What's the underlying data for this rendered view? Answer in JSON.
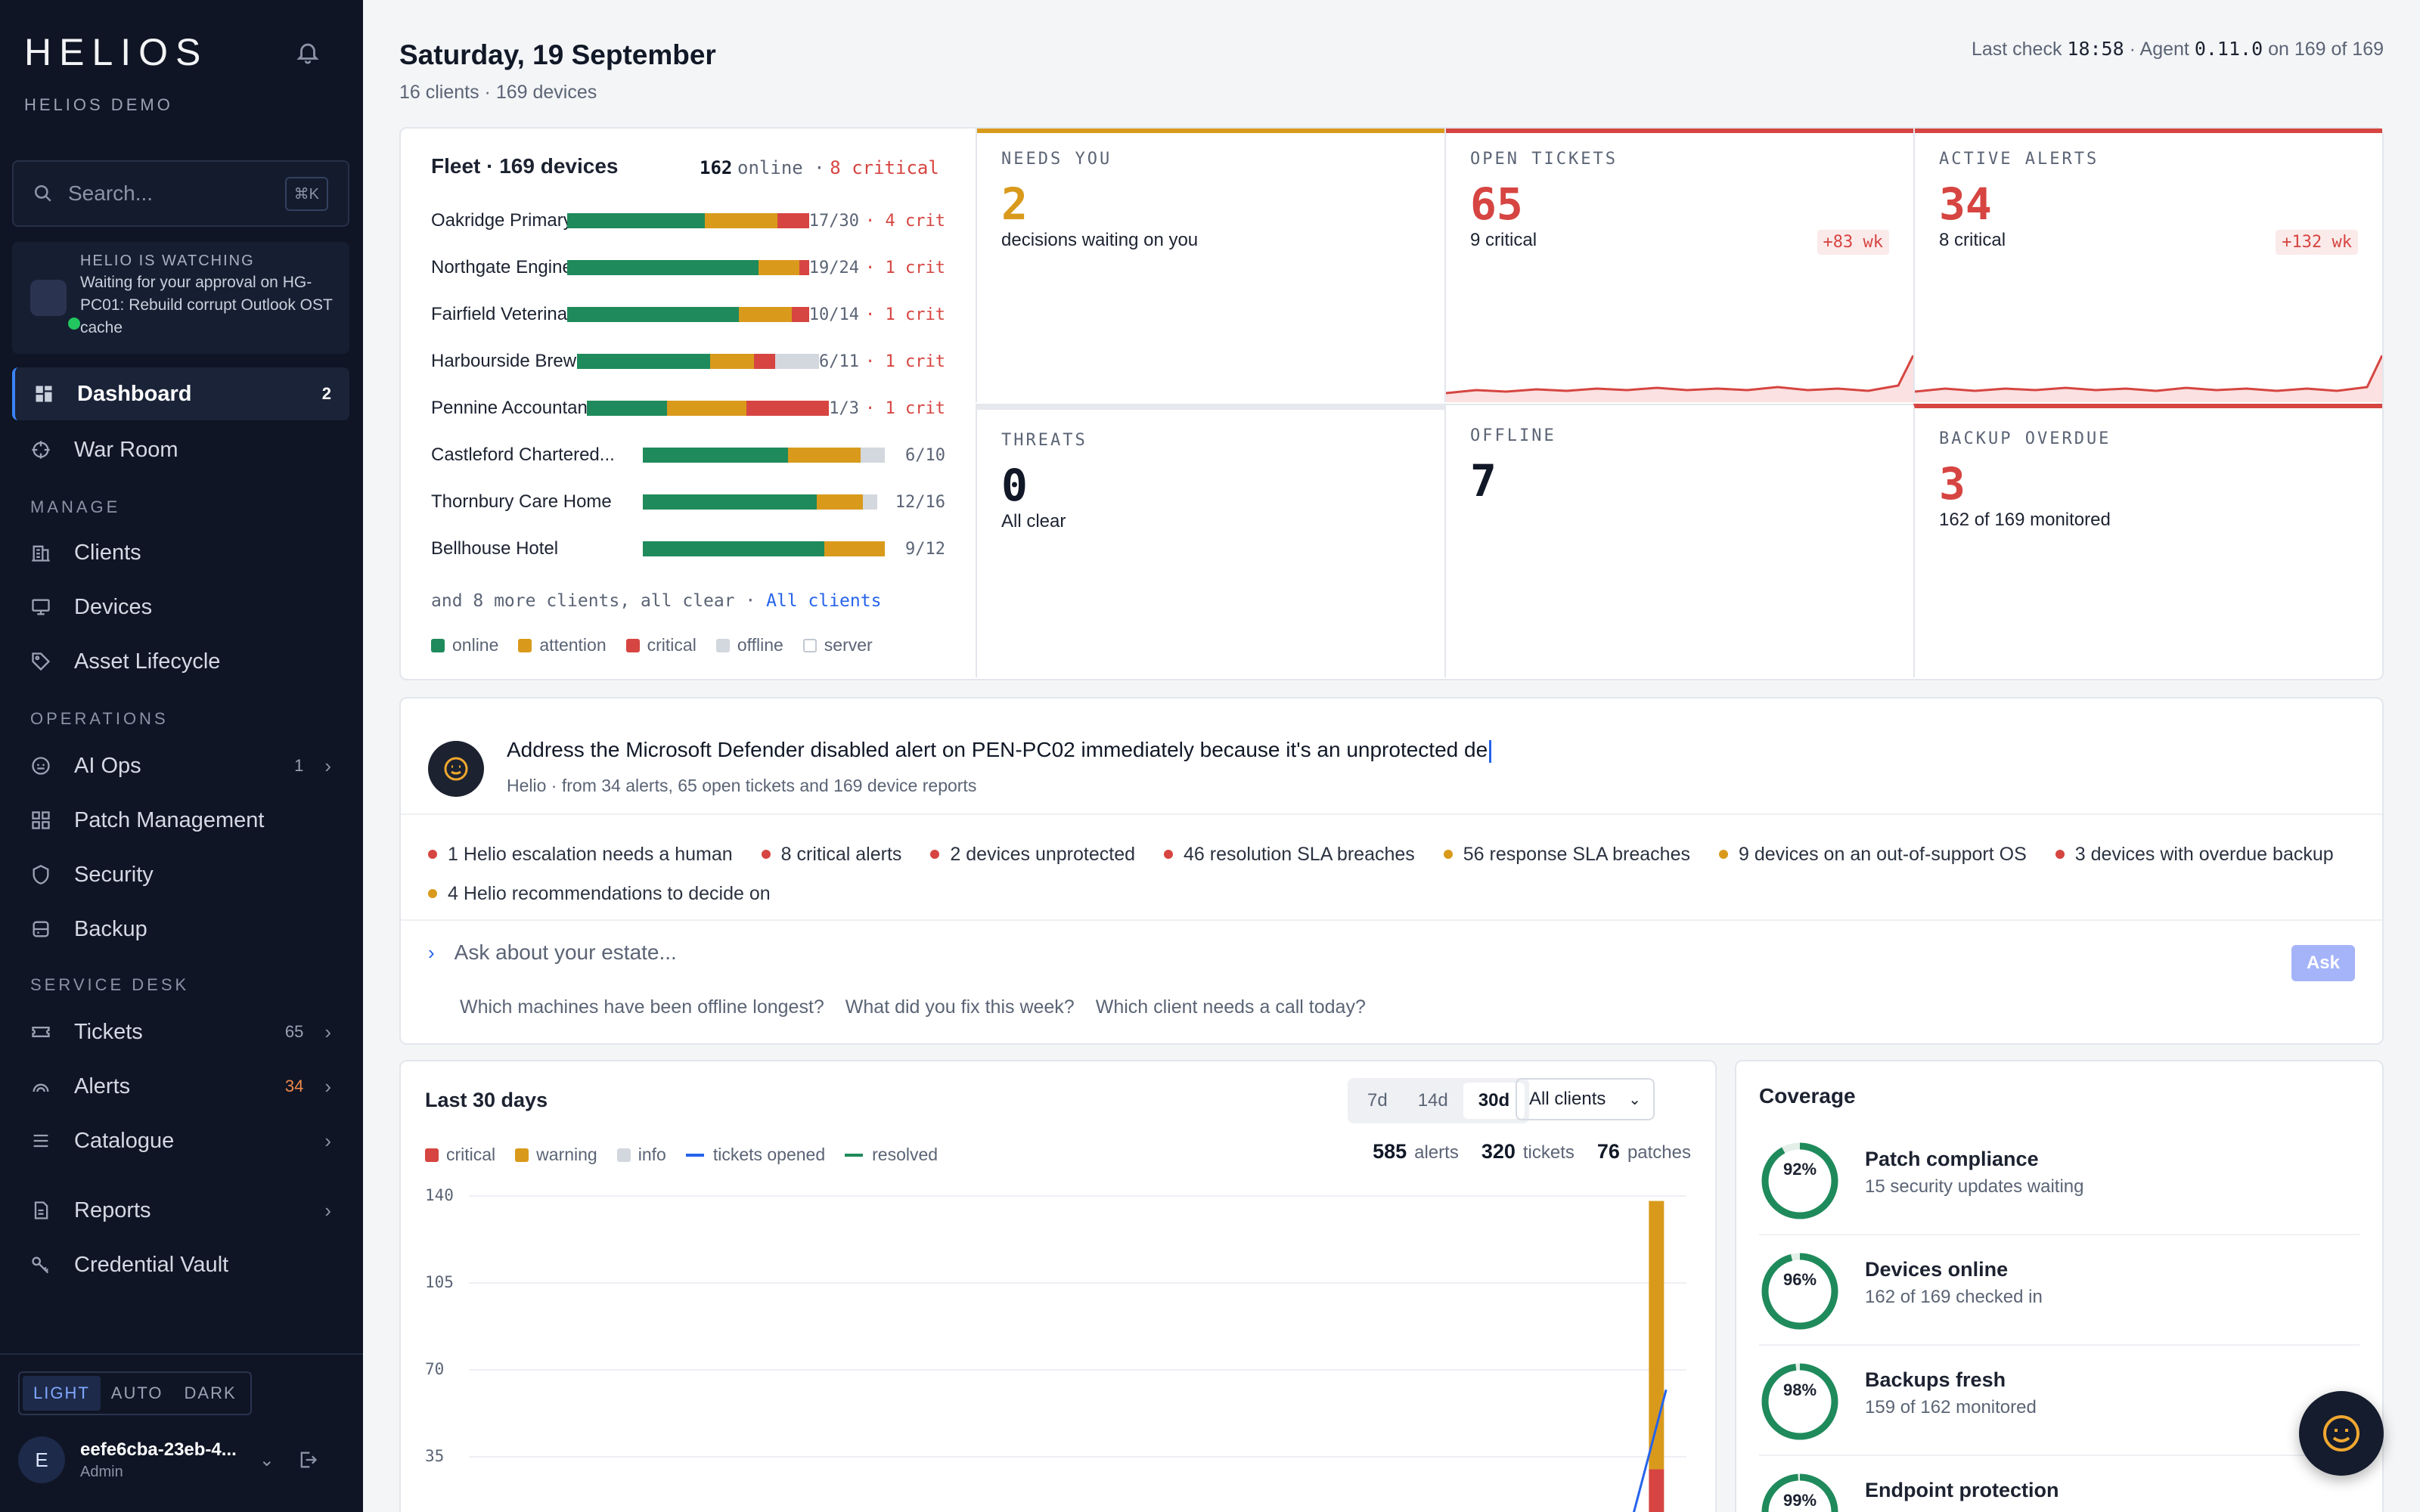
{
  "sidebar": {
    "logo": "HELIOS",
    "org": "HELIOS DEMO",
    "search_placeholder": "Search...",
    "search_shortcut": "⌘K",
    "watch_title": "HELIO IS WATCHING",
    "watch_text": "Waiting for your approval on HG-PC01: Rebuild corrupt Outlook OST cache",
    "items": [
      {
        "label": "Dashboard",
        "count": "2",
        "icon": "dashboard-icon"
      },
      {
        "label": "War Room",
        "icon": "crosshair-icon"
      },
      {
        "label": "Clients",
        "icon": "building-icon"
      },
      {
        "label": "Devices",
        "icon": "monitor-icon"
      },
      {
        "label": "Asset Lifecycle",
        "icon": "tag-icon"
      },
      {
        "label": "AI Ops",
        "count": "1",
        "icon": "robot-icon"
      },
      {
        "label": "Patch Management",
        "icon": "grid-icon"
      },
      {
        "label": "Security",
        "icon": "shield-icon"
      },
      {
        "label": "Backup",
        "icon": "database-icon"
      },
      {
        "label": "Tickets",
        "count": "65",
        "icon": "ticket-icon"
      },
      {
        "label": "Alerts",
        "count": "34",
        "icon": "signal-icon"
      },
      {
        "label": "Catalogue",
        "icon": "list-icon"
      },
      {
        "label": "Reports",
        "icon": "report-icon"
      },
      {
        "label": "Credential Vault",
        "icon": "key-icon"
      }
    ],
    "sections": [
      "MANAGE",
      "OPERATIONS",
      "SERVICE DESK"
    ],
    "theme": [
      "LIGHT",
      "AUTO",
      "DARK"
    ],
    "user_name": "eefe6cba-23eb-4...",
    "user_role": "Admin",
    "user_initial": "E"
  },
  "header": {
    "date": "Saturday, 19 September",
    "summary": "16 clients · 169 devices",
    "last_check_label": "Last check",
    "last_check_time": "18:58",
    "agent_label": "· Agent",
    "agent_version": "0.11.0",
    "agent_coverage": "on 169 of 169"
  },
  "fleet": {
    "title": "Fleet · 169 devices",
    "online": "162",
    "online_label": "online ·",
    "critical": "8 critical",
    "rows": [
      {
        "name": "Oakridge Primary Sc...",
        "value": "17/30",
        "crit": "· 4 crit",
        "segments": [
          0.57,
          0.3,
          0.13,
          0
        ]
      },
      {
        "name": "Northgate Engineering",
        "value": "19/24",
        "crit": "· 1 crit",
        "segments": [
          0.79,
          0.17,
          0.04,
          0
        ]
      },
      {
        "name": "Fairfield Veterinary ...",
        "value": "10/14",
        "crit": "· 1 crit",
        "segments": [
          0.71,
          0.22,
          0.07,
          0
        ]
      },
      {
        "name": "Harbourside Brewin...",
        "value": "6/11",
        "crit": "· 1 crit",
        "segments": [
          0.55,
          0.18,
          0.09,
          0.18
        ]
      },
      {
        "name": "Pennine Accountancy",
        "value": "1/3",
        "crit": "· 1 crit",
        "segments": [
          0.33,
          0.33,
          0.34,
          0
        ]
      },
      {
        "name": "Castleford Chartered...",
        "value": "6/10",
        "crit": "",
        "segments": [
          0.6,
          0.3,
          0,
          0.1
        ]
      },
      {
        "name": "Thornbury Care Home",
        "value": "12/16",
        "crit": "",
        "segments": [
          0.72,
          0.19,
          0,
          0.06
        ]
      },
      {
        "name": "Bellhouse Hotel",
        "value": "9/12",
        "crit": "",
        "segments": [
          0.75,
          0.25,
          0,
          0
        ]
      }
    ],
    "more_text": "and 8 more clients, all clear ·",
    "more_link": "All clients",
    "legend": [
      "online",
      "attention",
      "critical",
      "offline",
      "server"
    ]
  },
  "tiles": [
    {
      "label": "NEEDS YOU",
      "value": "2",
      "sub": "decisions waiting on you",
      "color": "#d99a1c"
    },
    {
      "label": "OPEN TICKETS",
      "value": "65",
      "sub": "9 critical",
      "delta": "+83 wk",
      "color": "#d64541"
    },
    {
      "label": "ACTIVE ALERTS",
      "value": "34",
      "sub": "8 critical",
      "delta": "+132 wk",
      "color": "#d64541"
    },
    {
      "label": "THREATS",
      "value": "0",
      "sub": "All clear",
      "color": "#111827"
    },
    {
      "label": "OFFLINE",
      "value": "7",
      "sub": "",
      "color": "#111827"
    },
    {
      "label": "BACKUP OVERDUE",
      "value": "3",
      "sub": "162 of 169 monitored",
      "color": "#d64541"
    }
  ],
  "helio": {
    "statement": "Address the Microsoft Defender disabled alert on PEN-PC02 immediately because it's an unprotected de",
    "source": "Helio · from 34 alerts, 65 open tickets and 169 device reports",
    "chips": [
      {
        "text": "1 Helio escalation needs a human",
        "color": "#d64541"
      },
      {
        "text": "8 critical alerts",
        "color": "#d64541"
      },
      {
        "text": "2 devices unprotected",
        "color": "#d64541"
      },
      {
        "text": "46 resolution SLA breaches",
        "color": "#d64541"
      },
      {
        "text": "56 response SLA breaches",
        "color": "#d99a1c"
      },
      {
        "text": "9 devices on an out-of-support OS",
        "color": "#d99a1c"
      },
      {
        "text": "3 devices with overdue backup",
        "color": "#d64541"
      },
      {
        "text": "4 Helio recommendations to decide on",
        "color": "#d99a1c"
      }
    ],
    "ask_placeholder": "Ask about your estate...",
    "ask_button": "Ask",
    "suggestions": [
      "Which machines have been offline longest?",
      "What did you fix this week?",
      "Which client needs a call today?"
    ]
  },
  "activity": {
    "title": "Last 30 days",
    "ranges": [
      "7d",
      "14d",
      "30d"
    ],
    "selected_range": "30d",
    "client_filter": "All clients",
    "legend": [
      "critical",
      "warning",
      "info",
      "tickets opened",
      "resolved"
    ],
    "totals": {
      "alerts": "585",
      "alerts_label": "alerts",
      "tickets": "320",
      "tickets_label": "tickets",
      "patches": "76",
      "patches_label": "patches"
    }
  },
  "chart_data": {
    "type": "bar",
    "title": "Last 30 days",
    "y_ticks": [
      "140",
      "105",
      "70",
      "35"
    ],
    "ylim": [
      0,
      140
    ],
    "grid": true,
    "series": [
      {
        "name": "critical",
        "values": [
          0,
          0,
          0,
          0,
          0,
          0,
          0,
          0,
          0,
          0,
          0,
          0,
          0,
          0,
          0,
          0,
          0,
          0,
          0,
          0,
          0,
          0,
          0,
          0,
          0,
          0,
          0,
          0,
          0,
          30
        ]
      },
      {
        "name": "warning",
        "values": [
          0,
          0,
          0,
          0,
          0,
          0,
          0,
          0,
          0,
          0,
          0,
          0,
          0,
          0,
          0,
          0,
          0,
          0,
          0,
          0,
          0,
          0,
          0,
          0,
          0,
          0,
          0,
          0,
          0,
          108
        ]
      },
      {
        "name": "tickets opened",
        "values": [
          0,
          0,
          0,
          0,
          0,
          0,
          0,
          0,
          0,
          0,
          0,
          0,
          0,
          0,
          0,
          0,
          0,
          0,
          0,
          0,
          0,
          0,
          0,
          0,
          0,
          0,
          0,
          0,
          0,
          62
        ]
      }
    ],
    "colors": {
      "critical": "#d64541",
      "warning": "#d99a1c",
      "info": "#d3d7de",
      "tickets opened": "#2563eb",
      "resolved": "#1f8a5b"
    }
  },
  "coverage": {
    "title": "Coverage",
    "items": [
      {
        "name": "Patch compliance",
        "sub": "15 security updates waiting",
        "pct": 92,
        "label": "92%"
      },
      {
        "name": "Devices online",
        "sub": "162 of 169 checked in",
        "pct": 96,
        "label": "96%"
      },
      {
        "name": "Backups fresh",
        "sub": "159 of 162 monitored",
        "pct": 98,
        "label": "98%"
      },
      {
        "name": "Endpoint protection",
        "sub": "",
        "pct": 99,
        "label": "99%"
      }
    ]
  },
  "colors": {
    "online": "#1f8a5b",
    "attention": "#d99a1c",
    "critical": "#d64541",
    "offline": "#d3d7de",
    "accent": "#2563eb"
  }
}
